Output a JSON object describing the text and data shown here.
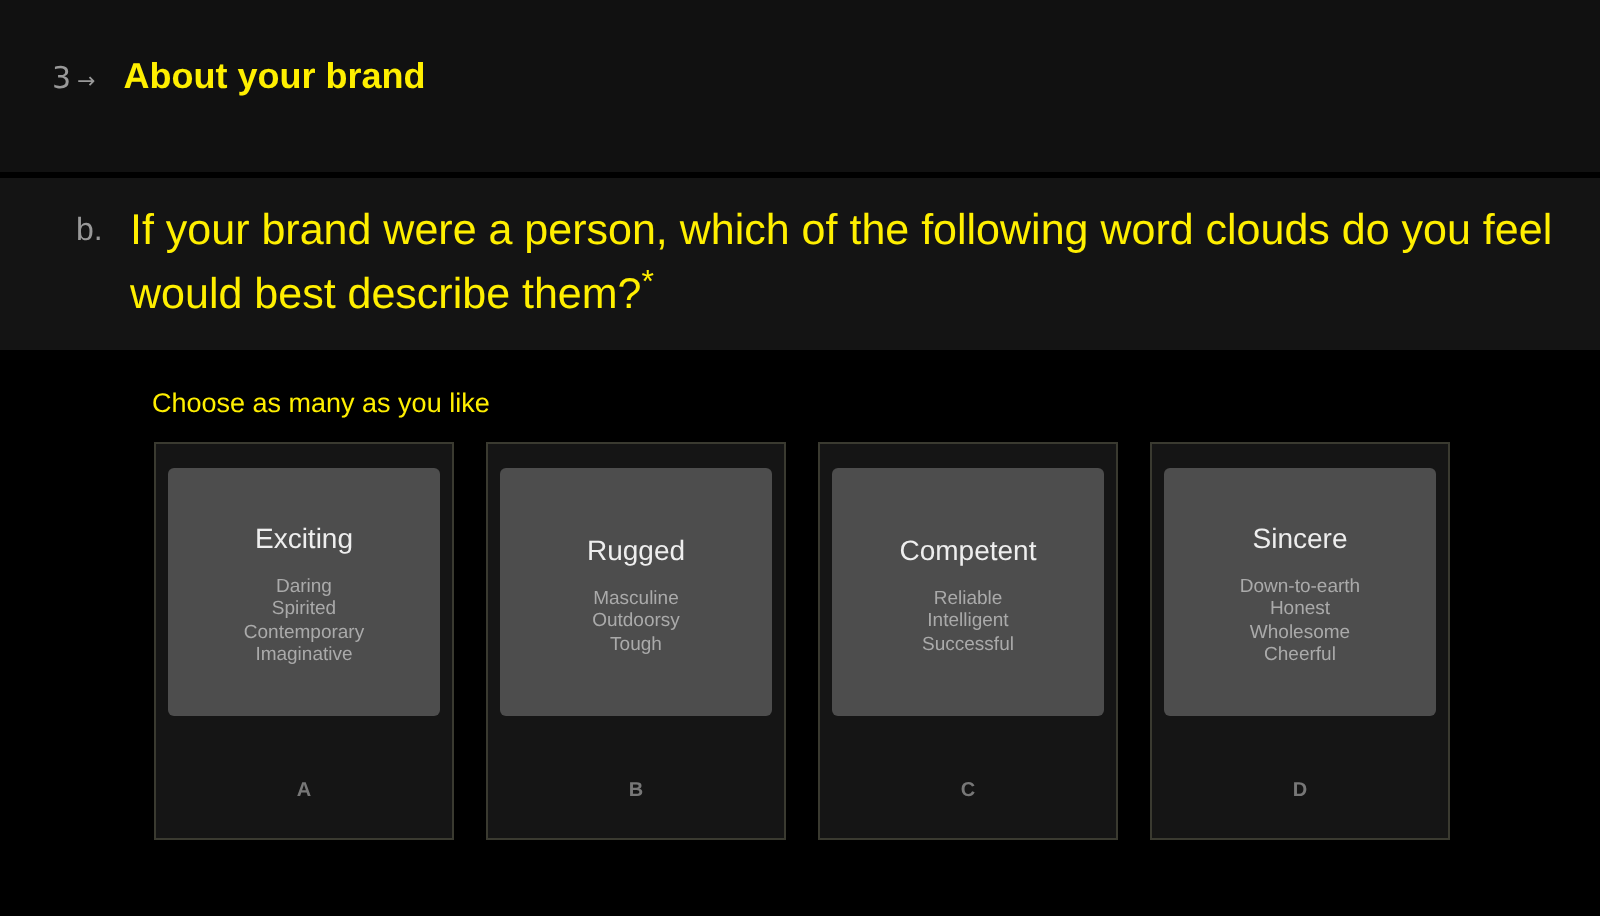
{
  "section": {
    "number": "3",
    "arrow": "→",
    "title": "About your brand"
  },
  "question": {
    "letter": "b.",
    "text": "If your brand were a person, which of the following word clouds do you feel would best describe them?$^{*}$"
  },
  "hint": "Choose as many as you like",
  "choices": [
    {
      "title": "Exciting",
      "words": [
        "Daring",
        "Spirited",
        "Contemporary",
        "Imaginative"
      ],
      "letter": "A",
      "selected": false
    },
    {
      "title": "Rugged",
      "words": [
        "Masculine",
        "Outdoorsy",
        "Tough"
      ],
      "letter": "B",
      "selected": false
    },
    {
      "title": "Competent",
      "words": [
        "Reliable",
        "Intelligent",
        "Successful"
      ],
      "letter": "C",
      "selected": false
    },
    {
      "title": "Sincere",
      "words": [
        "Down-to-earth",
        "Honest",
        "Wholesome",
        "Cheerful"
      ],
      "letter": "D",
      "selected": false
    }
  ]
}
